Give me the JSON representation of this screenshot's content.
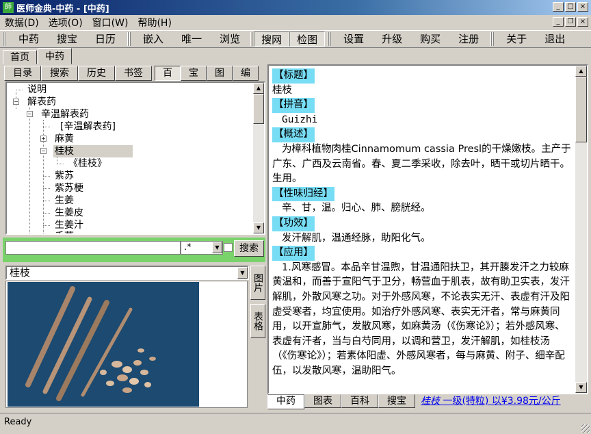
{
  "window": {
    "title": "医师金典-中药 - [中药]",
    "icon_text": "師",
    "controls": [
      "_",
      "□",
      "×"
    ],
    "mdi_controls": [
      "_",
      "❐",
      "×"
    ]
  },
  "menu": [
    "数据(D)",
    "选项(O)",
    "窗口(W)",
    "帮助(H)"
  ],
  "toolbar": {
    "group1": [
      "中药",
      "搜宝",
      "日历"
    ],
    "group2": [
      "嵌入",
      "唯一",
      "浏览"
    ],
    "group3": [
      "搜网",
      "检图"
    ],
    "group4": [
      "设置",
      "升级",
      "购买",
      "注册"
    ],
    "group5": [
      "关于",
      "退出"
    ]
  },
  "doc_tabs": [
    "首页",
    "中药"
  ],
  "left_tabs": [
    "目录",
    "搜索",
    "历史",
    "书签"
  ],
  "left_small_tabs": [
    "百",
    "宝",
    "图",
    "编"
  ],
  "tree": {
    "n1": "说明",
    "n2": "解表药",
    "n3": "辛温解表药",
    "n4": "[辛温解表药]",
    "n5": "麻黄",
    "n6": "桂枝",
    "n7": "《桂枝》",
    "n8": "紫苏",
    "n9": "紫苏梗",
    "n10": "生姜",
    "n11": "生姜皮",
    "n12": "生姜汁",
    "n13": "香薷"
  },
  "search": {
    "value": "",
    "regex": ".*",
    "button": "搜索"
  },
  "image_combo": "桂枝",
  "side_tabs": [
    "图片",
    "表格"
  ],
  "article": {
    "h_title": "【标题】",
    "title": "桂枝",
    "h_pinyin": "【拼音】",
    "pinyin": "Guizhi",
    "h_overview": "【概述】",
    "overview": "为樟科植物肉桂Cinnamomum cassia Presl的干燥嫩枝。主产于广东、广西及云南省。春、夏二季采收，除去叶，晒干或切片晒干。生用。",
    "h_nature": "【性味归经】",
    "nature": "辛、甘，温。归心、肺、膀胱经。",
    "h_effect": "【功效】",
    "effect": "发汗解肌，温通经脉，助阳化气。",
    "h_usage": "【应用】",
    "usage": "1.风寒感冒。本品辛甘温煦，甘温通阳扶卫，其开腠发汗之力较麻黄温和，而善于宣阳气于卫分，畅营血于肌表，故有助卫实表，发汗解肌，外散风寒之功。对于外感风寒，不论表实无汗、表虚有汗及阳虚受寒者，均宜使用。如治疗外感风寒、表实无汗者，常与麻黄同用，以开宣肺气，发散风寒，如麻黄汤（《伤寒论》）；若外感风寒、表虚有汗者，当与白芍同用，以调和营卫，发汗解肌，如桂枝汤（《伤寒论》）；若素体阳虚、外感风寒者，每与麻黄、附子、细辛配伍，以发散风寒，温助阳气。"
  },
  "bottom_tabs": [
    "中药",
    "图表",
    "百科",
    "搜宝"
  ],
  "bottom_link": {
    "name": "桂枝",
    "text": " 一级(特粒) 以¥3.98元/公斤"
  },
  "status": "Ready",
  "colors": {
    "title_gradient_start": "#0a246a",
    "header_highlight": "#77ddf5",
    "search_strip": "#7ad36a",
    "photo_background": "#1c4a70"
  }
}
